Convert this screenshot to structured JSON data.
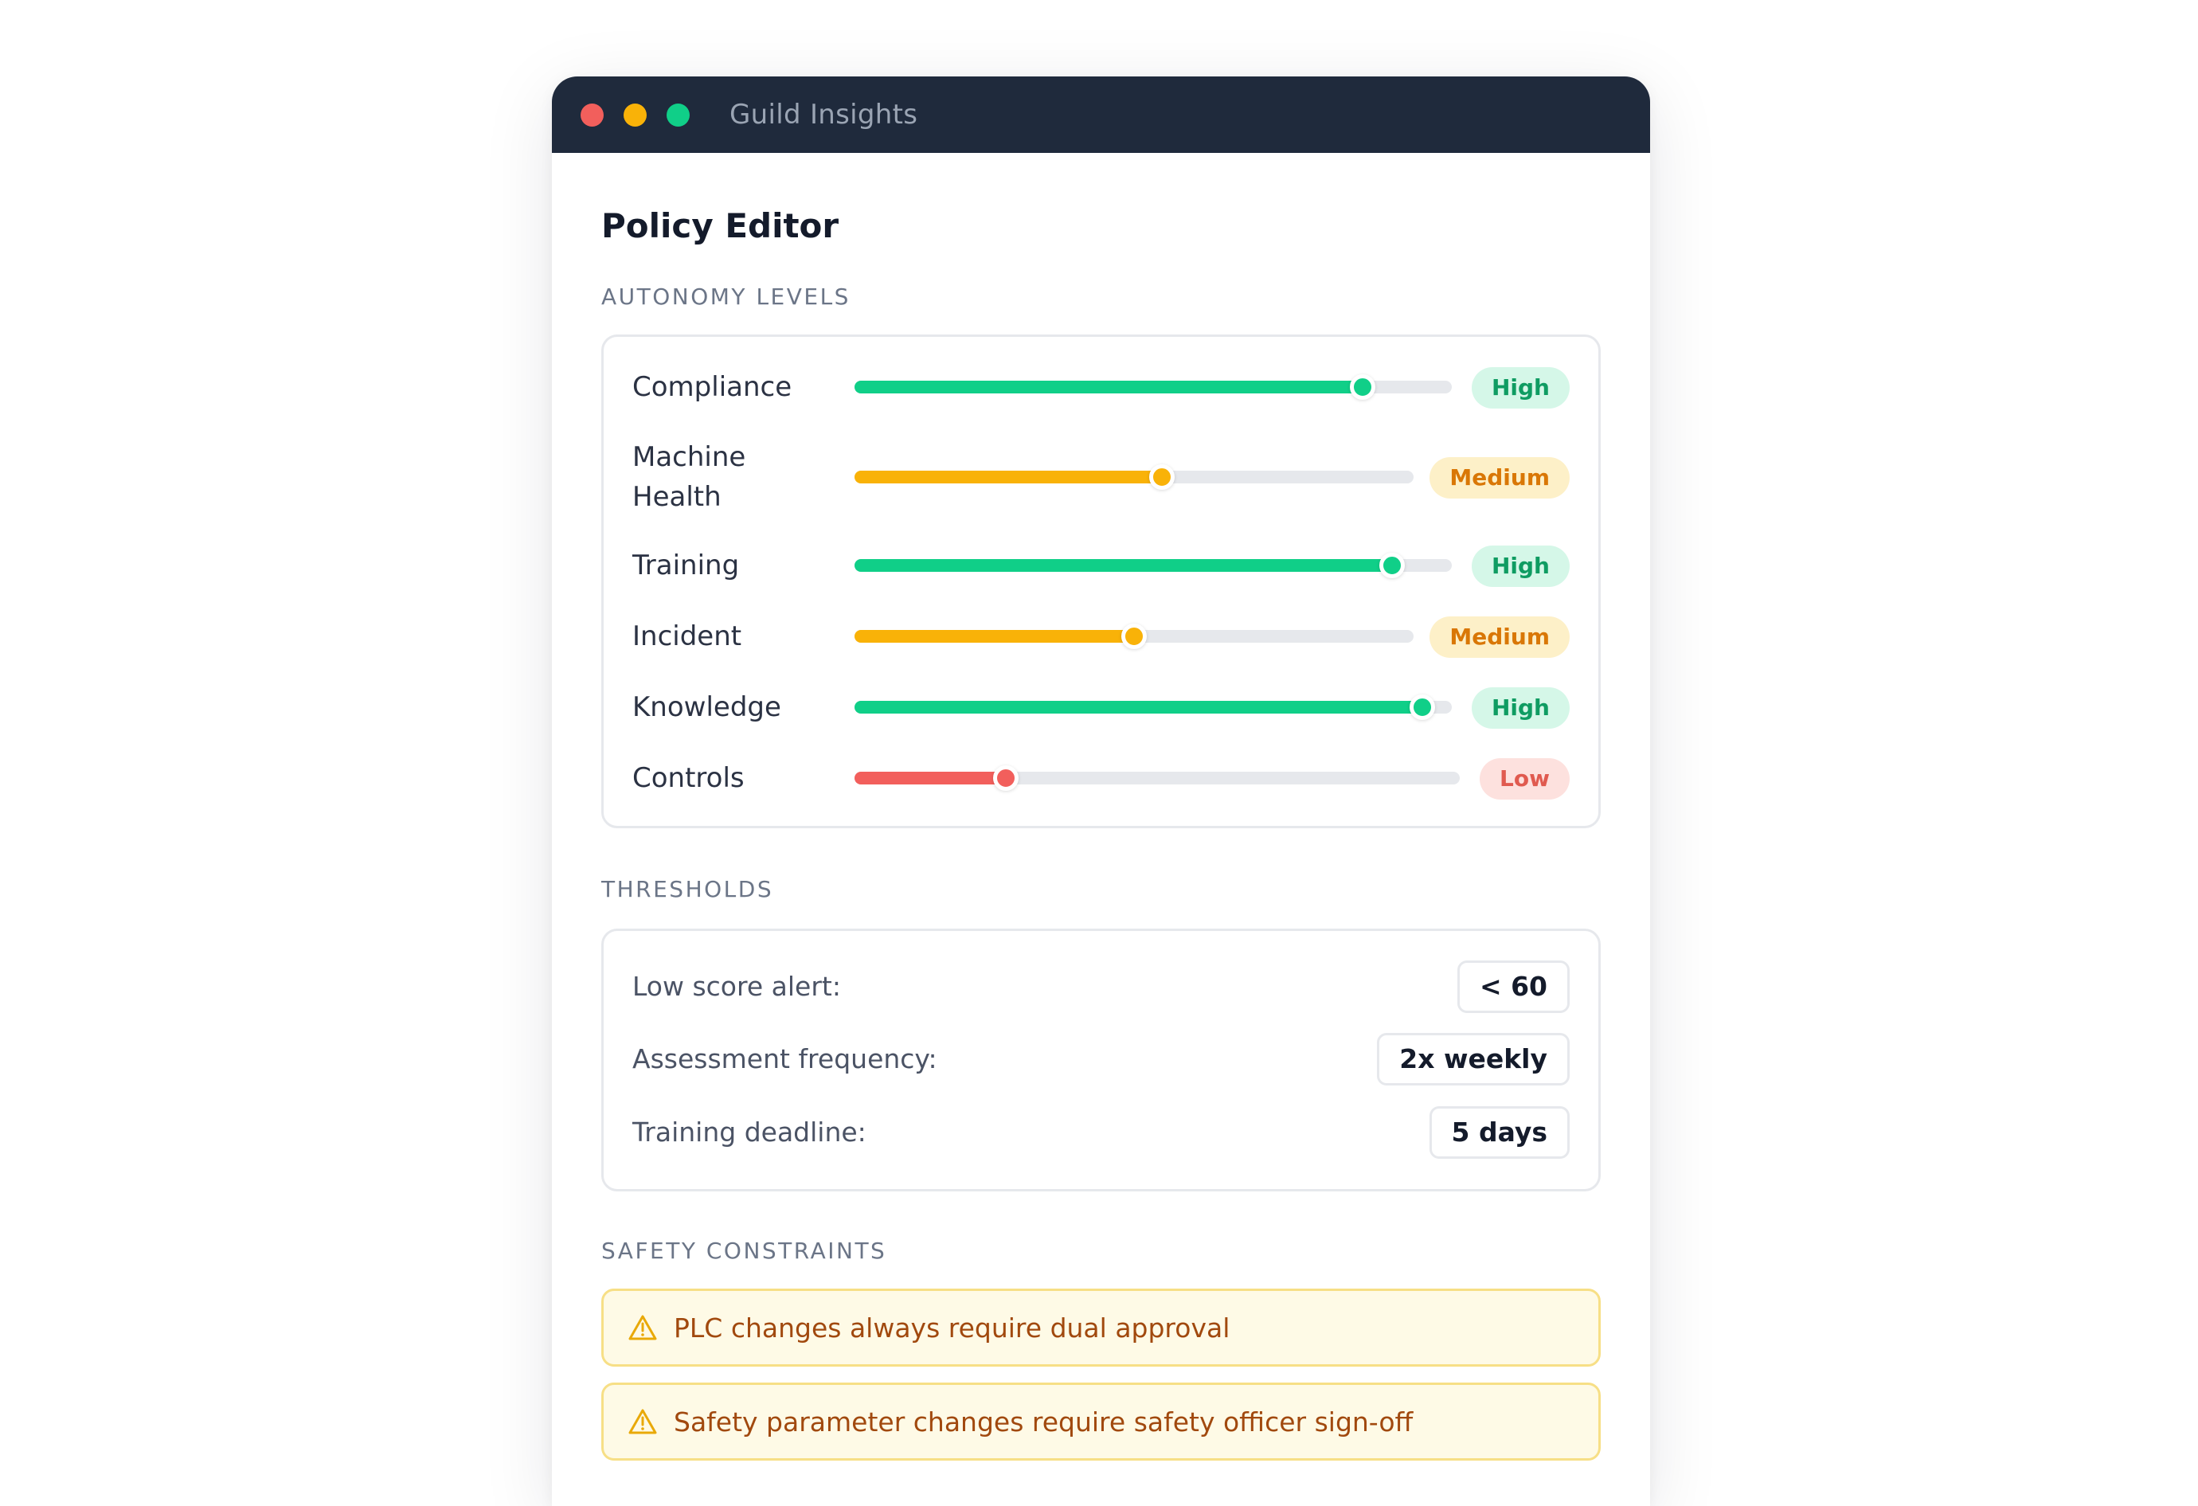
{
  "window": {
    "title": "Guild Insights",
    "controls": [
      "close",
      "minimize",
      "maximize"
    ]
  },
  "page": {
    "title": "Policy Editor"
  },
  "autonomy": {
    "section_label": "AUTONOMY LEVELS",
    "items": [
      {
        "label": "Compliance",
        "level": "High",
        "value_fraction": 0.85,
        "color": "#10cf88"
      },
      {
        "label": "Machine Health",
        "level": "Medium",
        "value_fraction": 0.55,
        "color": "#f9b208"
      },
      {
        "label": "Training",
        "level": "High",
        "value_fraction": 0.9,
        "color": "#10cf88"
      },
      {
        "label": "Incident",
        "level": "Medium",
        "value_fraction": 0.5,
        "color": "#f9b208"
      },
      {
        "label": "Knowledge",
        "level": "High",
        "value_fraction": 0.95,
        "color": "#10cf88"
      },
      {
        "label": "Controls",
        "level": "Low",
        "value_fraction": 0.25,
        "color": "#f25f5c"
      }
    ]
  },
  "thresholds": {
    "section_label": "THRESHOLDS",
    "items": [
      {
        "label": "Low score alert:",
        "value": "< 60"
      },
      {
        "label": "Assessment frequency:",
        "value": "2x weekly"
      },
      {
        "label": "Training deadline:",
        "value": "5 days"
      }
    ]
  },
  "safety": {
    "section_label": "SAFETY CONSTRAINTS",
    "icon": "warning-icon",
    "items": [
      "PLC changes always require dual approval",
      "Safety parameter changes require safety officer sign-off"
    ]
  },
  "colors": {
    "titlebar": "#1f2a3c",
    "high": "#10cf88",
    "medium": "#f9b208",
    "low": "#f25f5c"
  }
}
